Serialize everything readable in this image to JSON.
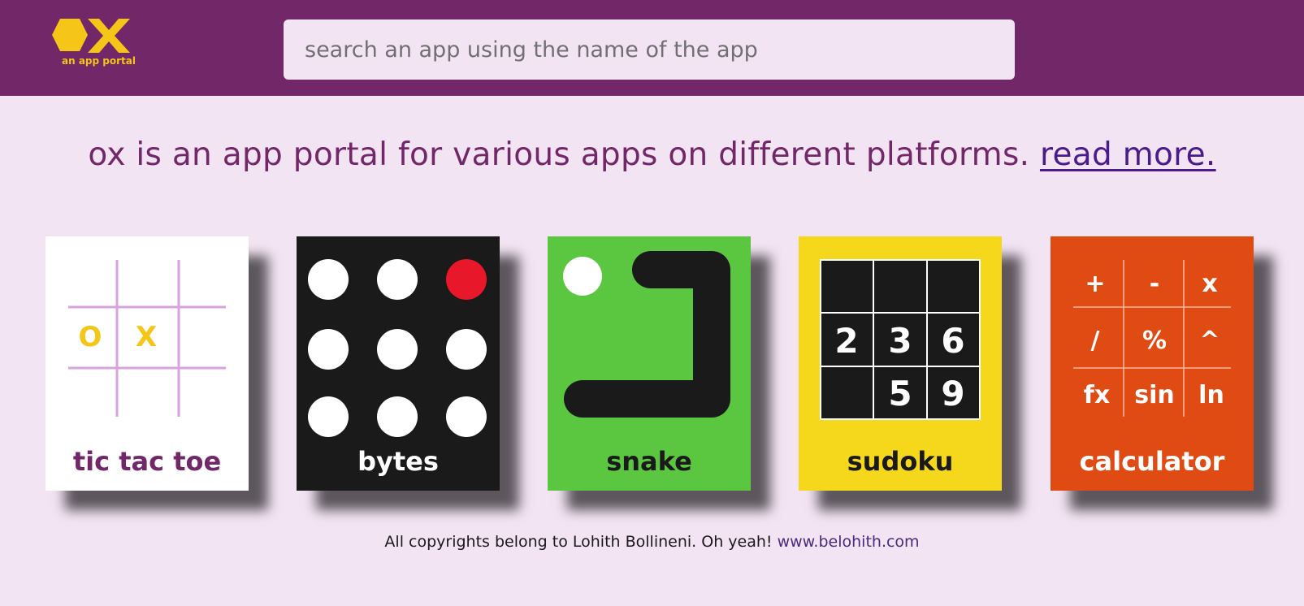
{
  "header": {
    "logo_text": "OX",
    "logo_tagline": "an app portal",
    "search_placeholder": "search an app using the name of the app"
  },
  "intro": {
    "text": "ox is an app portal for various apps on different platforms.",
    "link_text": "read more."
  },
  "apps": [
    {
      "label": "tic tac toe",
      "icon": "tic-tac-toe-board-icon",
      "bg": "#ffffff",
      "fg": "#722768",
      "cells": [
        "",
        "",
        "",
        "O",
        "X",
        "",
        "",
        "",
        ""
      ]
    },
    {
      "label": "bytes",
      "icon": "dot-grid-icon",
      "bg": "#1a1a1a",
      "fg": "#ffffff"
    },
    {
      "label": "snake",
      "icon": "snake-icon",
      "bg": "#5bc740",
      "fg": "#1a1a1a"
    },
    {
      "label": "sudoku",
      "icon": "sudoku-grid-icon",
      "bg": "#f5d81c",
      "fg": "#1a1a1a",
      "cells": [
        "",
        "",
        "",
        "2",
        "3",
        "6",
        "",
        "5",
        "9"
      ]
    },
    {
      "label": "calculator",
      "icon": "calculator-keys-icon",
      "bg": "#e04b14",
      "fg": "#ffffff",
      "keys": [
        "+",
        "-",
        "x",
        "/",
        "%",
        "^",
        "fx",
        "sin",
        "ln"
      ]
    }
  ],
  "footer": {
    "text": "All copyrights belong to Lohith Bollineni. Oh yeah!",
    "link_text": "www.belohith.com"
  }
}
